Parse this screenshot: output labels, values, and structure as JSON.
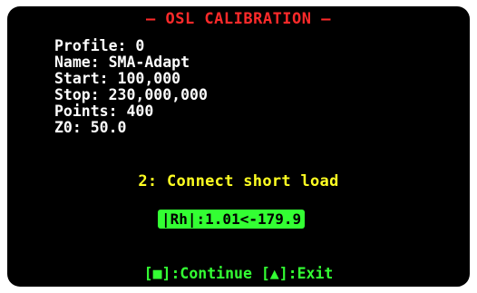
{
  "colors": {
    "screen_bg": "#000000",
    "title": "#ff2a2a",
    "info_text": "#ffffff",
    "step_text": "#ffff22",
    "accent_green": "#33ff33"
  },
  "header": {
    "title": "— OSL CALIBRATION —"
  },
  "info": {
    "profile": "Profile: 0",
    "name": "Name: SMA-Adapt",
    "start": "Start: 100,000",
    "stop": "Stop: 230,000,000",
    "points": "Points: 400",
    "z0": "Z0: 50.0"
  },
  "step": {
    "instruction": "2: Connect short load"
  },
  "readout": {
    "value": "|Rh|:1.01<-179.9"
  },
  "footer": {
    "continue_key": "[■]",
    "continue_label": ":Continue",
    "exit_key": "[▲]",
    "exit_label": ":Exit"
  }
}
